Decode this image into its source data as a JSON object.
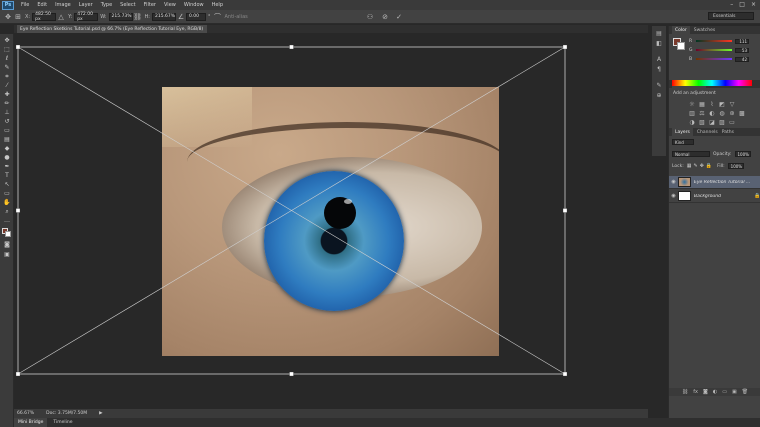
{
  "menu": [
    "File",
    "Edit",
    "Image",
    "Layer",
    "Type",
    "Select",
    "Filter",
    "View",
    "Window",
    "Help"
  ],
  "app_logo": "Ps",
  "window_controls": [
    "–",
    "□",
    "×"
  ],
  "options": {
    "x_value": "482.50 px",
    "y_value": "472.00 px",
    "w_value": "215.73%",
    "h_value": "215.67%",
    "angle_value": "0.00",
    "angle_symbol": "°",
    "antialias_label": "Anti-alias",
    "workspace": "Essentials"
  },
  "document_tab": "Eye Reflection Sketkins Tutorial.psd @ 66.7% (Eye Reflection Tutorial Eye, RGB/8)",
  "panels": {
    "color_tabs": [
      "Color",
      "Swatches"
    ],
    "rgb": [
      {
        "ch": "R",
        "val": "111"
      },
      {
        "ch": "G",
        "val": "53"
      },
      {
        "ch": "B",
        "val": "42"
      }
    ],
    "adjust_tabs": [
      "Adjustments",
      "Styles"
    ],
    "adjust_title": "Add an adjustment",
    "layers_tabs": [
      "Layers",
      "Channels",
      "Paths"
    ],
    "kind": "Kind",
    "blend_mode": "Normal",
    "opacity_label": "Opacity:",
    "opacity_value": "100%",
    "lock_label": "Lock:",
    "fill_label": "Fill:",
    "fill_value": "100%",
    "layers": [
      "Eye Reflection Tutorial ...",
      "Background"
    ]
  },
  "status": {
    "zoom": "66.67%",
    "doc": "Doc: 3.75M/7.50M"
  },
  "bottom_tabs": [
    "Mini Bridge",
    "Timeline"
  ],
  "icons": {
    "move": "move-icon",
    "cancel": "cancel-transform-icon",
    "commit": "commit-check-icon"
  }
}
